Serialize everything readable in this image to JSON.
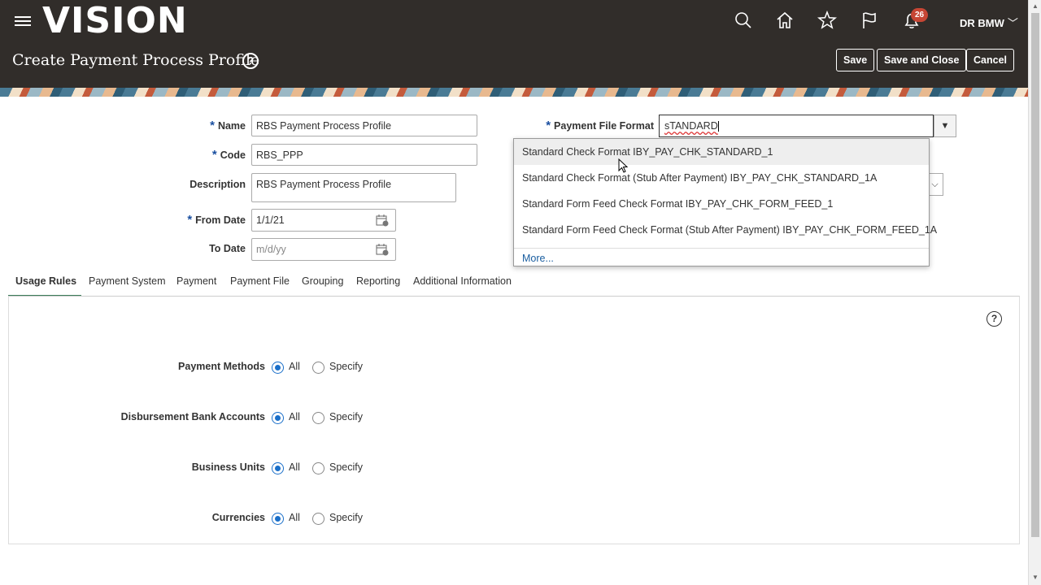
{
  "header": {
    "logo": "VISION",
    "notification_count": "26",
    "user": "DR BMW",
    "page_title": "Create Payment Process Profile",
    "help_glyph": "?",
    "buttons": {
      "save": "Save",
      "save_close": "Save and Close",
      "cancel": "Cancel"
    },
    "icons": [
      "menu-icon",
      "search-icon",
      "home-icon",
      "star-icon",
      "flag-icon",
      "bell-icon",
      "chevron-down-icon"
    ]
  },
  "form": {
    "required_mark": "*",
    "name_label": "Name",
    "name_value": "RBS Payment Process Profile",
    "code_label": "Code",
    "code_value": "RBS_PPP",
    "description_label": "Description",
    "description_value": "RBS Payment Process Profile",
    "from_date_label": "From Date",
    "from_date_value": "1/1/21",
    "to_date_label": "To Date",
    "to_date_placeholder": "m/d/yy",
    "pff_label": "Payment File Format",
    "pff_value": "sTANDARD"
  },
  "dropdown": {
    "items": [
      "Standard Check Format IBY_PAY_CHK_STANDARD_1",
      "Standard Check Format (Stub After Payment) IBY_PAY_CHK_STANDARD_1A",
      "Standard Form Feed Check Format IBY_PAY_CHK_FORM_FEED_1",
      "Standard Form Feed Check Format (Stub After Payment) IBY_PAY_CHK_FORM_FEED_1A"
    ],
    "more": "More..."
  },
  "tabs": [
    "Usage Rules",
    "Payment System",
    "Payment",
    "Payment File",
    "Grouping",
    "Reporting",
    "Additional Information"
  ],
  "usage_rules": {
    "rows": [
      {
        "label": "Payment Methods",
        "selected": "All"
      },
      {
        "label": "Disbursement Bank Accounts",
        "selected": "All"
      },
      {
        "label": "Business Units",
        "selected": "All"
      },
      {
        "label": "Currencies",
        "selected": "All"
      }
    ],
    "option_all": "All",
    "option_specify": "Specify"
  },
  "colors": {
    "header_bg": "#312d2a",
    "accent": "#1a6fc9",
    "tab_underline": "#3c7d5a",
    "badge": "#c74634"
  }
}
